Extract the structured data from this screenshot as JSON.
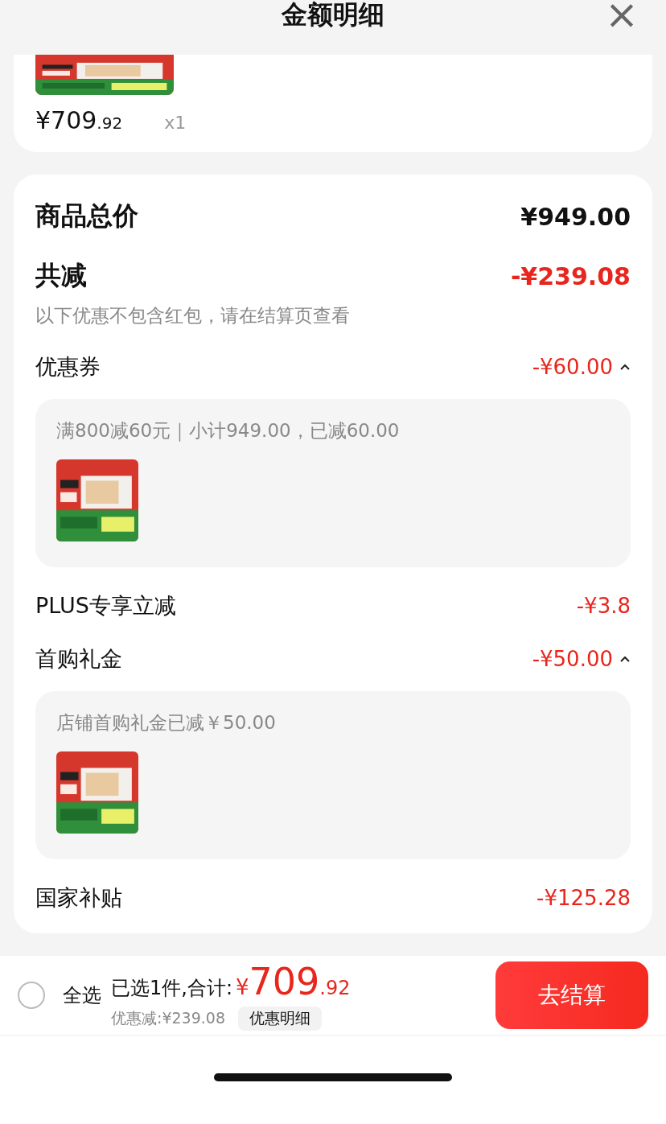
{
  "header": {
    "title": "金额明细",
    "close": "×"
  },
  "product": {
    "price": {
      "main": "¥709",
      "decimal": ".92"
    },
    "quantity": "x1"
  },
  "rows": [
    {
      "kind": "total",
      "label": "商品总价",
      "amount": "¥949.00"
    },
    {
      "kind": "reduction",
      "label": "共减",
      "amount": "-¥239.08",
      "note": "以下优惠不包含红包，请在结算页查看"
    },
    {
      "kind": "discount",
      "label": "优惠券",
      "amount": "-¥60.00",
      "expanded": true,
      "detail": {
        "text": "满800减60元｜小计949.00，已减60.00"
      }
    },
    {
      "kind": "discount",
      "label": "PLUS专享立减",
      "amount": "-¥3.8"
    },
    {
      "kind": "discount",
      "label": "首购礼金",
      "amount": "-¥50.00",
      "expanded": true,
      "detail": {
        "text": "店铺首购礼金已减￥50.00"
      }
    },
    {
      "kind": "discount",
      "label": "国家补贴",
      "amount": "-¥125.28"
    }
  ],
  "footer": {
    "select_all": {
      "label": "全选",
      "checked": false
    },
    "summary": "已选1件,合计:",
    "total": {
      "currency": "¥",
      "main": "709",
      "decimal": ".92"
    },
    "saved": "优惠减:¥239.08",
    "details_button": "优惠明细",
    "checkout": "去结算"
  }
}
